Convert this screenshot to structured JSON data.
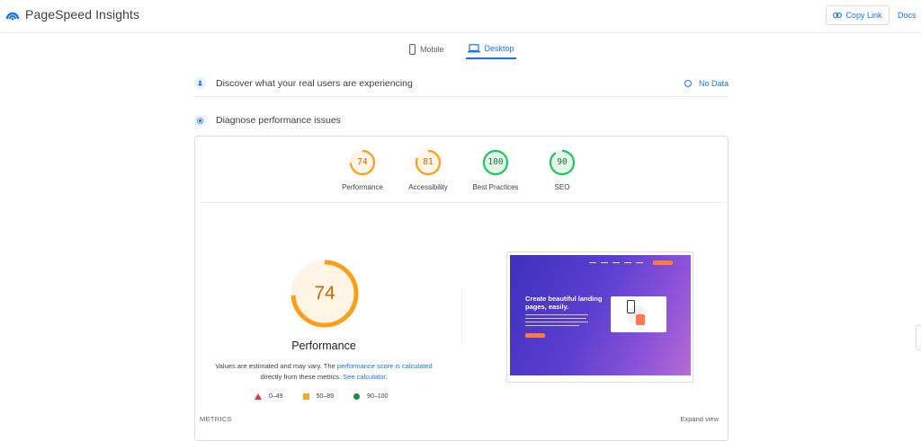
{
  "app": {
    "title": "PageSpeed Insights"
  },
  "header": {
    "copy_link": "Copy Link",
    "docs": "Docs"
  },
  "tabs": [
    {
      "label": "Mobile",
      "active": false
    },
    {
      "label": "Desktop",
      "active": true
    }
  ],
  "field_data": {
    "title": "Discover what your real users are experiencing",
    "status": "No Data"
  },
  "diagnose": {
    "title": "Diagnose performance issues"
  },
  "scores": [
    {
      "label": "Performance",
      "value": "74",
      "color": "#fa9f1b"
    },
    {
      "label": "Accessibility",
      "value": "81",
      "color": "#fa9f1b"
    },
    {
      "label": "Best Practices",
      "value": "100",
      "color": "#1ec95f"
    },
    {
      "label": "SEO",
      "value": "90",
      "color": "#1ec95f"
    }
  ],
  "main_score": {
    "value": "74",
    "label": "Performance",
    "desc_prefix": "Values are estimated and may vary. The ",
    "desc_link": "performance score is calculated",
    "desc_mid": " directly from these metrics. ",
    "desc_link2": "See calculator",
    "desc_suffix": "."
  },
  "legend": [
    {
      "range": "0–49",
      "color": "#e53935",
      "icon": "triangle-icon"
    },
    {
      "range": "50–89",
      "color": "#f9a825",
      "icon": "square-icon"
    },
    {
      "range": "90–100",
      "color": "#1e8e3e",
      "icon": "circle-icon"
    }
  ],
  "screenshot": {
    "headline": "Create beautiful landing pages, easily."
  },
  "metrics": {
    "title": "METRICS",
    "expand": "Expand view"
  }
}
